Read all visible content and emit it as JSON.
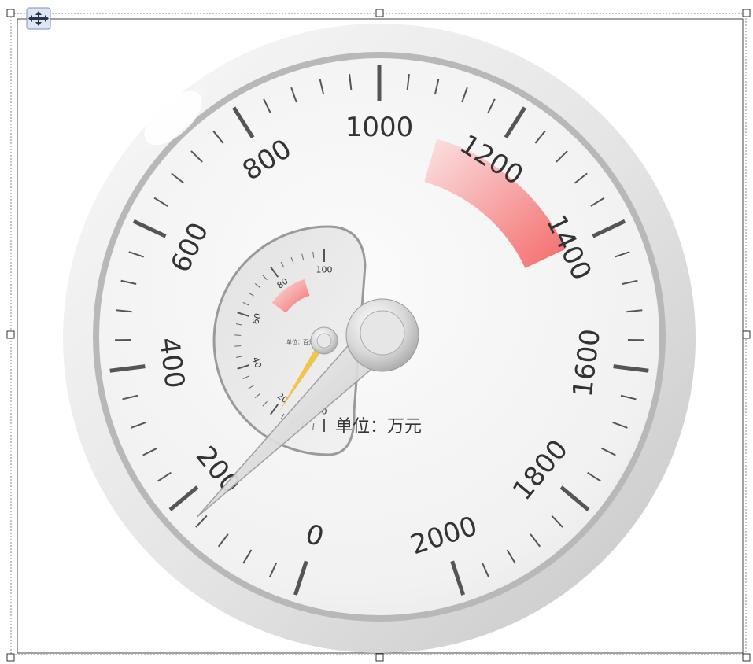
{
  "chart_data": [
    {
      "type": "gauge",
      "scale_min": 0,
      "scale_max": 2000,
      "major_ticks": [
        0,
        200,
        400,
        600,
        800,
        1000,
        1200,
        1400,
        1600,
        1800,
        2000
      ],
      "tick_labels": [
        "0",
        "200",
        "400",
        "600",
        "800",
        "1000",
        "1200",
        "1400",
        "1600",
        "1800",
        "2000"
      ],
      "minor_ticks_per_major": 4,
      "value": 170,
      "warning_band": [
        1100,
        1400
      ],
      "warning_color": "#f46a6a",
      "unit": "单位：万元"
    },
    {
      "type": "gauge",
      "scale_min": 0,
      "scale_max": 100,
      "major_ticks": [
        0,
        20,
        40,
        60,
        80,
        100
      ],
      "tick_labels": [
        "0",
        "20",
        "40",
        "60",
        "80",
        "100"
      ],
      "minor_ticks_per_major": 4,
      "value": 18,
      "warning_band": [
        70,
        90
      ],
      "warning_color": "#f46a6a",
      "inner_caption": "单位：百分"
    }
  ],
  "colors": {
    "needle_main": "#d6d6d6",
    "needle_small": "#f0c040",
    "rim": "#cfcfcf",
    "face": "#f6f6f6"
  },
  "icons": {
    "move_handle": "move-arrows-icon"
  }
}
